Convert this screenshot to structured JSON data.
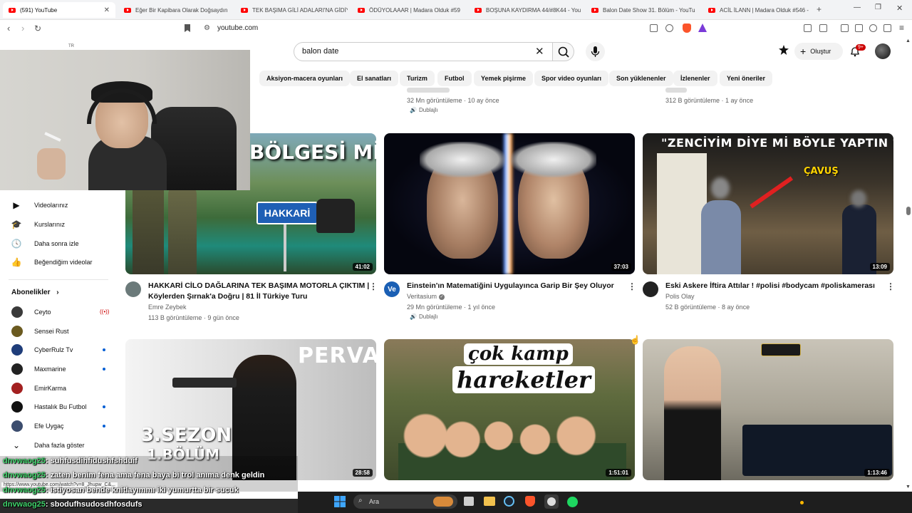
{
  "browser": {
    "tabs": [
      {
        "title": "(591) YouTube",
        "active": true
      },
      {
        "title": "Eğer Bir Kapibara Olarak Doğsaydın",
        "active": false
      },
      {
        "title": "TEK BAŞIMA GİLİ ADALARI'NA GİDİY",
        "active": false
      },
      {
        "title": "ÖDÜYOLAAAR | Madara Olduk #59",
        "active": false
      },
      {
        "title": "BOŞUNA KAYDIRMA 44/#8K44 - You",
        "active": false
      },
      {
        "title": "Balon Date Show 31. Bölüm - YouTu",
        "active": false
      },
      {
        "title": "ACİL İLANN | Madara Olduk #546 -",
        "active": false
      }
    ],
    "url": "youtube.com"
  },
  "header": {
    "logo_suffix": "TR",
    "search_value": "balon date",
    "create_label": "Oluştur",
    "notif_count": "9+"
  },
  "chips": [
    "Aksiyon-macera oyunları",
    "El sanatları",
    "Turizm",
    "Futbol",
    "Yemek pişirme",
    "Spor video oyunları",
    "Son yüklenenler",
    "İzlenenler",
    "Yeni öneriler"
  ],
  "top_row_partial": [
    {
      "meta": "32 Mn görüntüleme · 10 ay önce",
      "dub": "Dublajlı"
    },
    {
      "meta": "312 B görüntüleme · 1 ay önce"
    }
  ],
  "sidebar": {
    "items": [
      {
        "label": "Videolarınız",
        "icon": "play-square-icon"
      },
      {
        "label": "Kurslarınız",
        "icon": "graduation-cap-icon"
      },
      {
        "label": "Daha sonra izle",
        "icon": "clock-icon"
      },
      {
        "label": "Beğendiğim videolar",
        "icon": "thumbs-up-icon"
      }
    ],
    "subs_heading": "Abonelikler",
    "subscriptions": [
      {
        "name": "Ceyto",
        "status": "live",
        "color": "#3a3a3a"
      },
      {
        "name": "Sensei Rust",
        "status": "none",
        "color": "#6b5a20"
      },
      {
        "name": "CyberRulz Tv",
        "status": "new",
        "color": "#1f3d7a"
      },
      {
        "name": "Maxmarine",
        "status": "new",
        "color": "#222222"
      },
      {
        "name": "EmirKarma",
        "status": "none",
        "color": "#a32020"
      },
      {
        "name": "Hastalık Bu Futbol",
        "status": "new",
        "color": "#111111"
      },
      {
        "name": "Efe Uygaç",
        "status": "new",
        "color": "#3c4d6e"
      }
    ],
    "show_more": "Daha fazla göster"
  },
  "videos": [
    {
      "title_line1": "HAKKARİ CİLO DAĞLARINA TEK BAŞIMA MOTORLA ÇIKTIM |",
      "title_line2": "Köylerden Şırnak'a Doğru | 81 İl Türkiye Turu",
      "channel": "Emre Zeybek",
      "meta": "113 B görüntüleme · 9 gün önce",
      "duration": "41:02",
      "thumb_text": "BÖLGESİ Mİ ?",
      "sign_text": "HAKKARİ"
    },
    {
      "title_line1": "Einstein'ın Matematiğini Uygulayınca Garip Bir Şey Oluyor",
      "title_line2": "",
      "channel": "Veritasium",
      "channel_avatar_text": "Ve",
      "meta": "29 Mn görüntüleme · 1 yıl önce",
      "dub": "Dublajlı",
      "duration": "37:03"
    },
    {
      "title_line1": "Eski Askere İftira Attılar ! #polisi #bodycam #poliskamerası",
      "title_line2": "",
      "channel": "Polis Olay",
      "meta": "52 B görüntüleme · 8 ay önce",
      "duration": "13:09",
      "thumb_text": "\"ZENCİYİM DİYE Mİ BÖYLE YAPTIN ?\"",
      "sign_text": "ÇAVUŞ"
    },
    {
      "duration": "28:58",
      "thumb_text": "PERVARİ",
      "thumb_text2": "3.SEZON",
      "thumb_text3": "1.BÖLÜM"
    },
    {
      "duration": "1:51:01",
      "thumb_text": "çok kamp",
      "thumb_text2": "hareketler"
    },
    {
      "duration": "1:13:46"
    }
  ],
  "chat": [
    {
      "user": "dnvwaog25",
      "msg": ": suhfusdihfidushfshduif"
    },
    {
      "user": "dnvwaog25",
      "msg": ": zaten benim fena ama fena baya bi trol anıma denk geldin"
    },
    {
      "user": "dnvwaog25",
      "msg": ": istiyosan bende knitlayımmı iki yumurtta bir sucuk"
    },
    {
      "user": "dnvwaog25",
      "msg": ": sbodufhsudosdhfosdufs"
    }
  ],
  "status_url": "https://www.youtube.com/watch?v=8_Jhupw_C&...",
  "taskbar": {
    "search_placeholder": "Ara"
  }
}
